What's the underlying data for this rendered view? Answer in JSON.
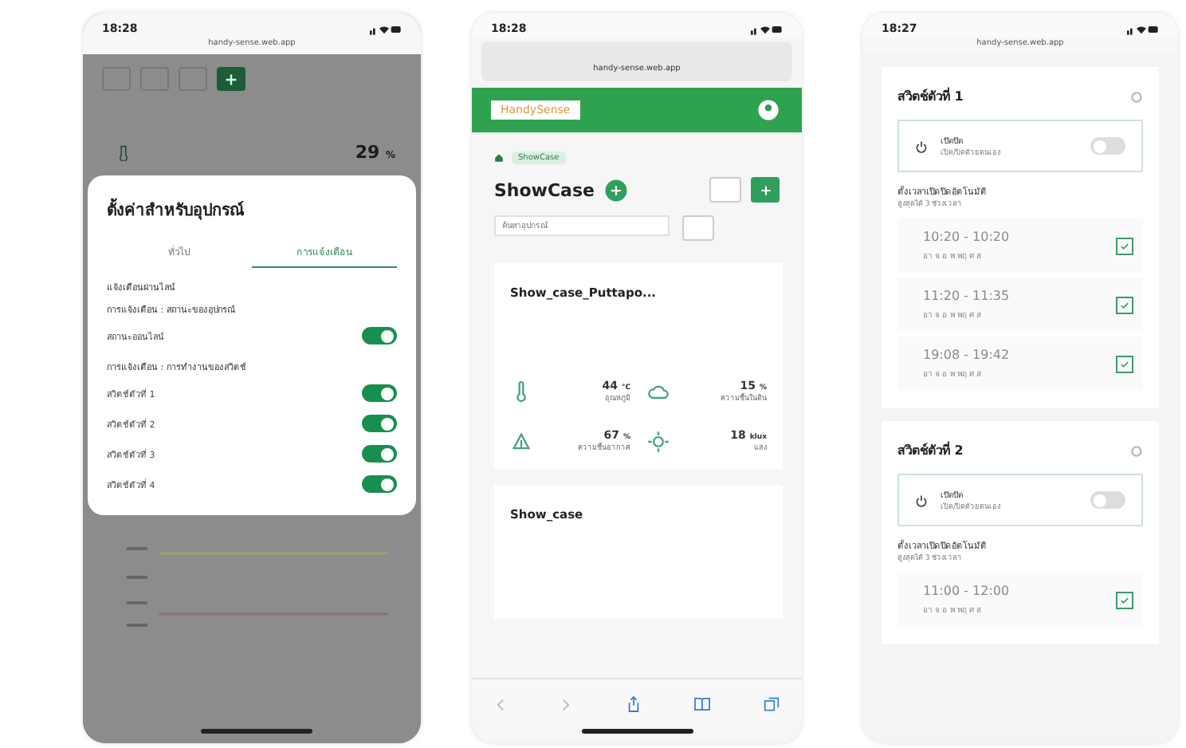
{
  "settings_screen": {
    "status_time": "18:28",
    "url": "handy-sense.web.app",
    "background_reading": "29",
    "background_unit": "%",
    "modal": {
      "title": "ตั้งค่าสำหรับอุปกรณ์",
      "tabs": [
        {
          "label": "ทั่วไป",
          "selected": false
        },
        {
          "label": "การแจ้งเตือน",
          "selected": true
        }
      ],
      "intro": "แจ้งเตือนผ่านไลน์",
      "groups": [
        {
          "title": "การแจ้งเตือน : สถานะของอุปกรณ์",
          "items": [
            {
              "label": "สถานะออนไลน์",
              "on": true
            }
          ]
        },
        {
          "title": "การแจ้งเตือน : การทำงานของสวิตช์",
          "items": [
            {
              "label": "สวิตช์ตัวที่ 1",
              "on": true
            },
            {
              "label": "สวิตช์ตัวที่ 2",
              "on": true
            },
            {
              "label": "สวิตช์ตัวที่ 3",
              "on": true
            },
            {
              "label": "สวิตช์ตัวที่ 4",
              "on": true
            }
          ]
        }
      ]
    }
  },
  "dashboard_screen": {
    "status_time": "18:28",
    "url": "handy-sense.web.app",
    "brand": "HandySense",
    "breadcrumb": "ShowCase",
    "title": "ShowCase",
    "search": {
      "placeholder": "ค้นหาอุปกรณ์"
    },
    "cards": [
      {
        "title": "Show_case_Puttapo...",
        "readings": [
          {
            "kind": "thermometer",
            "value": "44",
            "unit": "°C",
            "label": "อุณหภูมิ"
          },
          {
            "kind": "cloud",
            "value": "15",
            "unit": "%",
            "label": "ความชื้นในดิน"
          },
          {
            "kind": "plant",
            "value": "67",
            "unit": "%",
            "label": "ความชื้นอากาศ"
          },
          {
            "kind": "sun",
            "value": "18",
            "unit": "klux",
            "label": "แสง"
          }
        ]
      },
      {
        "title": "Show_case"
      }
    ]
  },
  "switch_screen": {
    "status_time": "18:27",
    "url": "handy-sense.web.app",
    "cards": [
      {
        "title": "สวิตช์ตัวที่ 1",
        "toggle_label": "เปิดปิด",
        "toggle_hint": "เปิด/ปิดด้วยตนเอง",
        "on": false,
        "schedule_title": "ตั้งเวลาเปิดปิดอัตโนมัติ",
        "schedule_hint": "สูงสุดได้ 3 ช่วงเวลา",
        "slots": [
          {
            "time": "10:20 - 10:20",
            "days": "อา จ อ พ พฤ ศ ส",
            "checked": true
          },
          {
            "time": "11:20 - 11:35",
            "days": "อา จ อ พ พฤ ศ ส",
            "checked": true
          },
          {
            "time": "19:08 - 19:42",
            "days": "อา จ อ พ พฤ ศ ส",
            "checked": true
          }
        ]
      },
      {
        "title": "สวิตช์ตัวที่ 2",
        "toggle_label": "เปิดปิด",
        "toggle_hint": "เปิด/ปิดด้วยตนเอง",
        "on": false,
        "schedule_title": "ตั้งเวลาเปิดปิดอัตโนมัติ",
        "schedule_hint": "สูงสุดได้ 3 ช่วงเวลา",
        "slots": [
          {
            "time": "11:00 - 12:00",
            "days": "อา จ อ พ พฤ ศ ส",
            "checked": true
          }
        ]
      }
    ]
  }
}
